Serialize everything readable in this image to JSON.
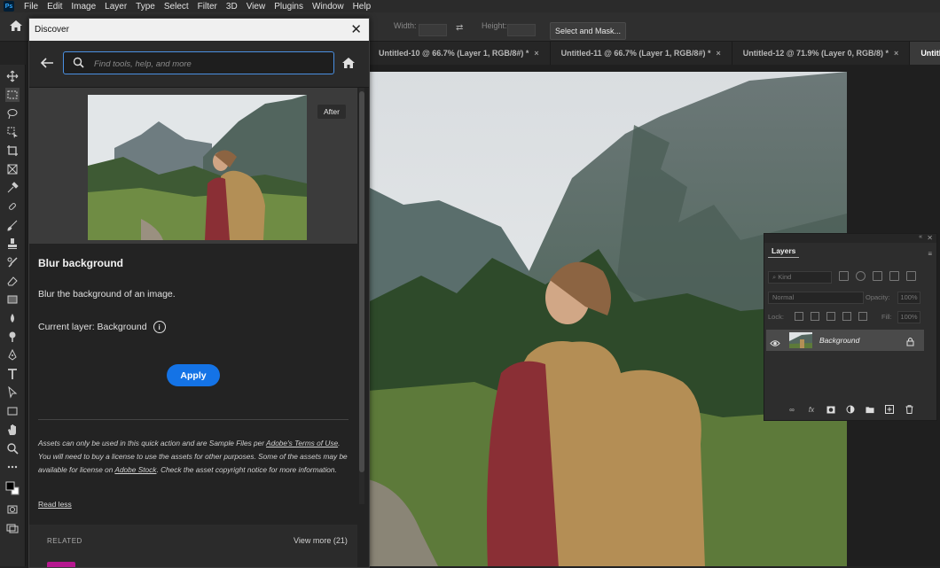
{
  "menubar": {
    "logo": "Ps",
    "items": [
      "File",
      "Edit",
      "Image",
      "Layer",
      "Type",
      "Select",
      "Filter",
      "3D",
      "View",
      "Plugins",
      "Window",
      "Help"
    ]
  },
  "options_bar": {
    "width_label": "Width:",
    "height_label": "Height:",
    "select_mask_label": "Select and Mask..."
  },
  "doc_tabs": [
    {
      "label": "Untitled-10 @ 66.7% (Layer 1, RGB/8#) *"
    },
    {
      "label": "Untitled-11 @ 66.7% (Layer 1, RGB/8#) *"
    },
    {
      "label": "Untitled-12 @ 71.9% (Layer 0, RGB/8) *"
    },
    {
      "label": "Untitl"
    }
  ],
  "discover": {
    "title": "Discover",
    "close": "✕",
    "search_placeholder": "Find tools, help, and more",
    "after_label": "After",
    "quick_action_title": "Blur background",
    "quick_action_desc": "Blur the background of an image.",
    "current_layer": "Current layer: Background",
    "info_glyph": "i",
    "apply_label": "Apply",
    "legal_1": "Assets can only be used in this quick action and are Sample Files per ",
    "legal_link_1": "Adobe's Terms of Use",
    "legal_2": ". You will need to buy a license to use the assets for other purposes. Some of the assets may be available for license on ",
    "legal_link_2": "Adobe Stock",
    "legal_3": ". Check the asset copyright notice for more information.",
    "read_less": "Read less",
    "related_label": "RELATED",
    "view_more": "View more (21)"
  },
  "layers_panel": {
    "tab_label": "Layers",
    "kind_label": "Kind",
    "blend_mode": "Normal",
    "opacity_label": "Opacity:",
    "opacity_value": "100%",
    "lock_label": "Lock:",
    "fill_label": "Fill:",
    "fill_value": "100%",
    "layer_name": "Background",
    "footer_icons": [
      "link-icon",
      "fx-icon",
      "mask-icon",
      "adjustment-icon",
      "folder-icon",
      "new-layer-icon",
      "trash-icon"
    ]
  },
  "colors": {
    "accent": "#1473e6",
    "search_border": "#4a90e2",
    "panel_bg": "#232323",
    "related_thumb": "#b5178f"
  }
}
